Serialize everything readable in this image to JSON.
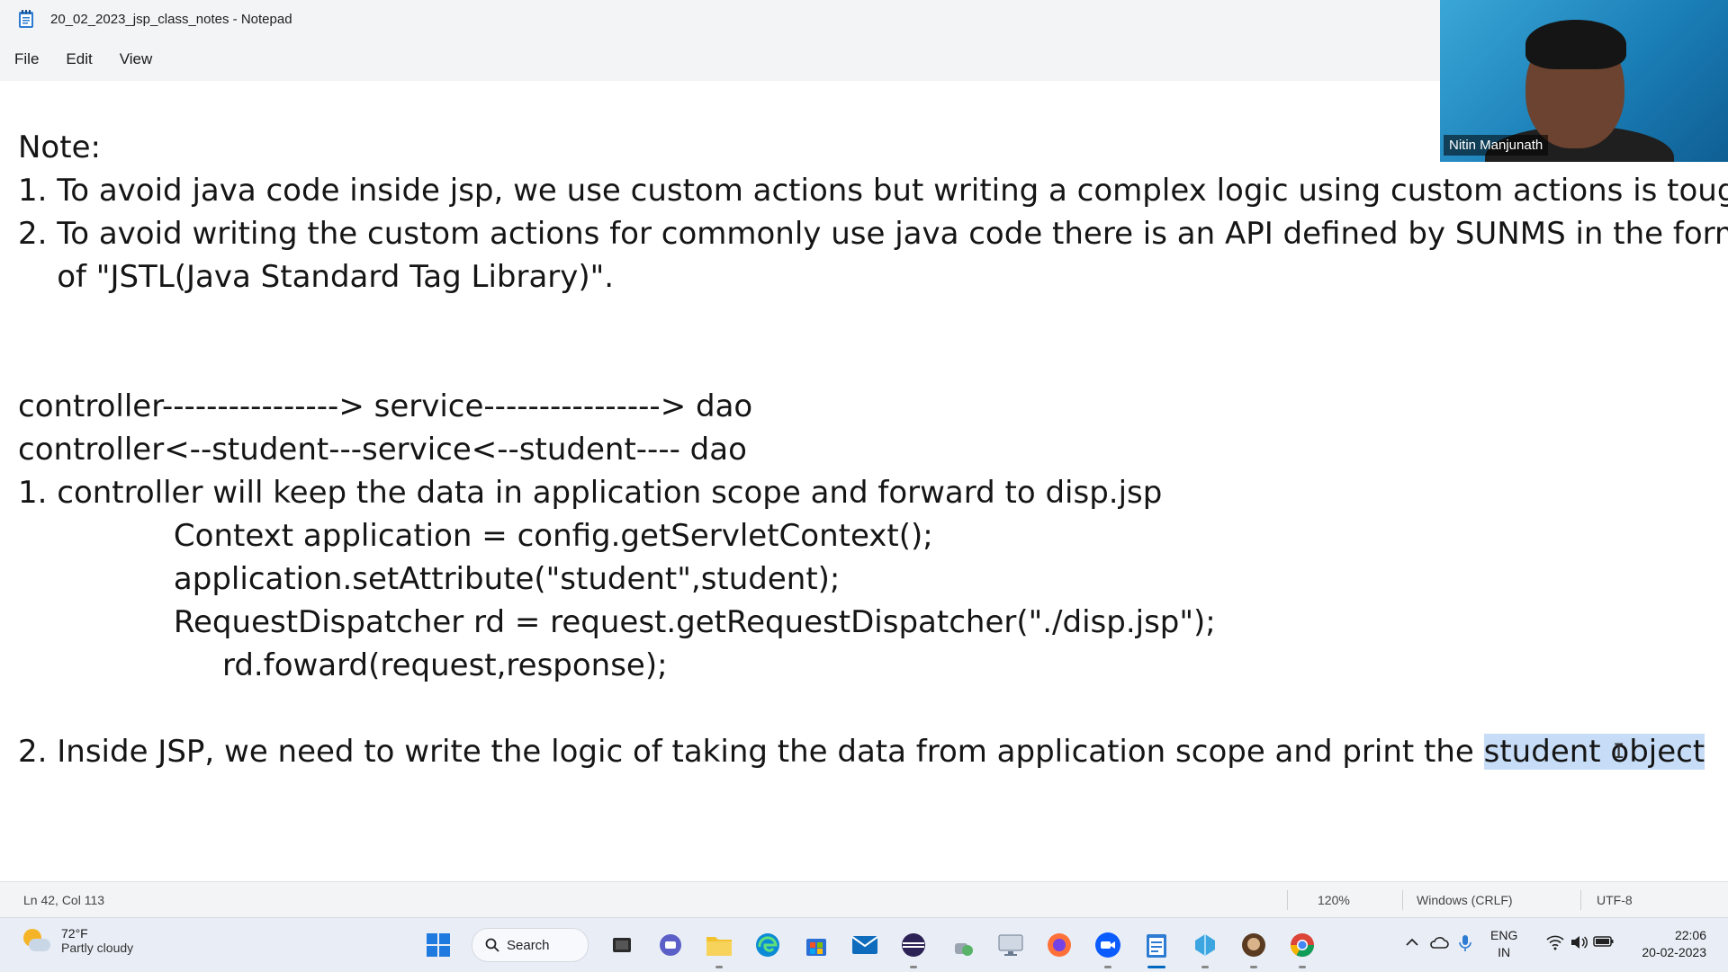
{
  "window": {
    "title": "20_02_2023_jsp_class_notes - Notepad",
    "app_icon": "notepad-icon"
  },
  "menu": [
    "File",
    "Edit",
    "View"
  ],
  "editor": {
    "lines": [
      {
        "text": "Note:"
      },
      {
        "text": "1. To avoid java code inside jsp, we use custom actions but writing a complex logic using custom actions is tough."
      },
      {
        "text": "2. To avoid writing the custom actions for commonly use java code there is an API defined by SUNMS in the form"
      },
      {
        "text": "    of \"JSTL(Java Standard Tag Library)\"."
      },
      {
        "text": "controller----------------> service----------------> dao"
      },
      {
        "text": "controller<--student---service<--student---- dao"
      },
      {
        "text": "1. controller will keep the data in application scope and forward to disp.jsp"
      },
      {
        "text": "                Context application = config.getServletContext();"
      },
      {
        "text": "                application.setAttribute(\"student\",student);"
      },
      {
        "text": "                RequestDispatcher rd = request.getRequestDispatcher(\"./disp.jsp\");"
      },
      {
        "text": "                     rd.foward(request,response);"
      },
      {
        "text": "2. Inside JSP, we need to write the logic of taking the data from application scope and print the ",
        "selected": "student object"
      }
    ]
  },
  "video": {
    "participant_name": "Nitin Manjunath"
  },
  "statusbar": {
    "position": "Ln 42, Col 113",
    "zoom": "120%",
    "line_ending": "Windows (CRLF)",
    "encoding": "UTF-8"
  },
  "taskbar": {
    "weather": {
      "temp": "72°F",
      "condition": "Partly cloudy"
    },
    "search_label": "Search",
    "apps": [
      "start-icon",
      "search",
      "file-explorer-dark-icon",
      "chat-icon",
      "folder-icon",
      "edge-icon",
      "store-icon",
      "mail-icon",
      "eclipse-icon",
      "java-icon",
      "remote-desktop-icon",
      "firefox-icon",
      "zoom-icon",
      "notepad-icon",
      "vscode-like-icon",
      "game-icon",
      "chrome-icon"
    ],
    "language": {
      "line1": "ENG",
      "line2": "IN"
    },
    "clock": {
      "time": "22:06",
      "date": "20-02-2023"
    }
  },
  "colors": {
    "selection": "#c7ddf7",
    "accent": "#0067c0"
  }
}
